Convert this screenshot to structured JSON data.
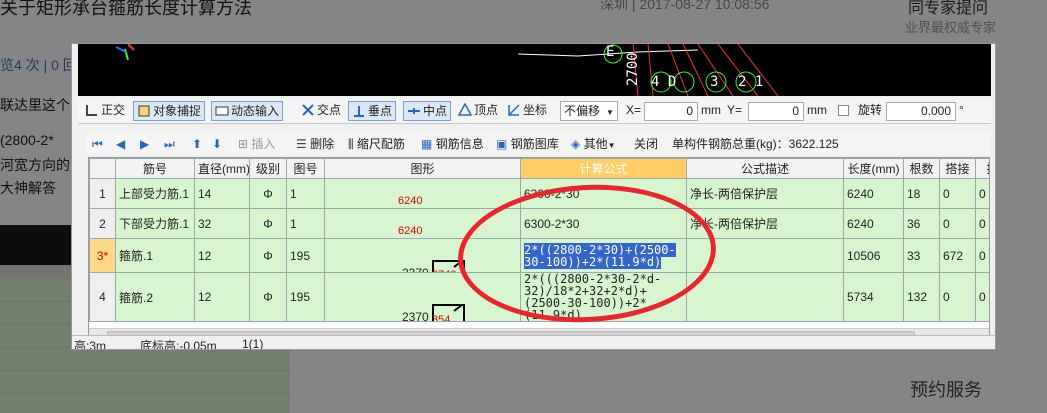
{
  "background": {
    "title_text": "关于矩形承台箍筋长度计算方法",
    "meta_location": "深圳 | ",
    "meta_date": "2017-08-27 10:08:56",
    "right_title": "同专家提问",
    "right_sub": "业界最权威专家",
    "left_line1": "览4 次 | 0 回",
    "left_line2": "联达里这个",
    "left_line3": "(2800-2*",
    "left_line4": "河宽方向的",
    "left_line5": "大神解答",
    "right_bottom": "预约服务"
  },
  "dialog": {
    "cad_labels": [
      "2700",
      "E",
      "4 D",
      "3",
      "2 1"
    ],
    "toolbar": {
      "zhengjiao": "正交",
      "duixiang_buzhuo": "对象捕捉",
      "dongtai_shuru": "动态输入",
      "jiaodian": "交点",
      "chuidian": "垂点",
      "zhongdian": "中点",
      "dingdian": "顶点",
      "zuobiao": "坐标",
      "pianyi_select": "不偏移",
      "x_label": "X=",
      "x_value": "0",
      "x_unit": "mm",
      "y_label": "Y=",
      "y_value": "0",
      "y_unit": "mm",
      "xuanzhuan": "旋转",
      "rotate_value": "0.000",
      "deg": "°"
    },
    "toolbar2": {
      "charu": "插入",
      "shanchu": "删除",
      "suochi": "缩尺配筋",
      "gangjin_xinxi": "钢筋信息",
      "gangjin_tuku": "钢筋图库",
      "qita": "其他",
      "guanbi": "关闭",
      "total_label": "单构件钢筋总重(kg)：3622.125"
    },
    "grid": {
      "headers": [
        "",
        "筋号",
        "直径(mm)",
        "级别",
        "图号",
        "图形",
        "计算公式",
        "公式描述",
        "长度(mm)",
        "根数",
        "搭接",
        "损"
      ],
      "rows": [
        {
          "idx": "1",
          "name": "上部受力筋.1",
          "dia": "14",
          "grade": "Φ",
          "fig": "1",
          "shape_num": "6240",
          "shape_left": "",
          "formula": "6300-2*30",
          "desc": "净长-两倍保护层",
          "len": "6240",
          "count": "18",
          "lap": "0",
          "loss": "0"
        },
        {
          "idx": "2",
          "name": "下部受力筋.1",
          "dia": "32",
          "grade": "Φ",
          "fig": "1",
          "shape_num": "6240",
          "shape_left": "",
          "formula": "6300-2*30",
          "desc": "净长-两倍保护层",
          "len": "6240",
          "count": "36",
          "lap": "0",
          "loss": "0"
        },
        {
          "idx": "3*",
          "name": "箍筋.1",
          "dia": "12",
          "grade": "Φ",
          "fig": "195",
          "shape_num": "2740",
          "shape_left": "2370",
          "formula": "2*((2800-2*30)+(2500-30-100))+2*(11.9*d)",
          "desc": "",
          "len": "10506",
          "count": "33",
          "lap": "672",
          "loss": "0"
        },
        {
          "idx": "4",
          "name": "箍筋.2",
          "dia": "12",
          "grade": "Φ",
          "fig": "195",
          "shape_num": "354",
          "shape_left": "2370",
          "formula": "2*(((2800-2*30-2*d-32)/18*2+32+2*d)+(2500-30-100))+2*(11.9*d)",
          "desc": "",
          "len": "5734",
          "count": "132",
          "lap": "0",
          "loss": "0"
        }
      ]
    },
    "status": {
      "height": "高:3m",
      "base_elev": "底标高:-0.05m",
      "page": "1(1)"
    },
    "close_icon_label": "×"
  },
  "colors": {
    "row_green": "#d7f5cf",
    "active_header": "#ffcc66",
    "annotation_red": "#e8262b",
    "selection_blue": "#3366cc"
  }
}
